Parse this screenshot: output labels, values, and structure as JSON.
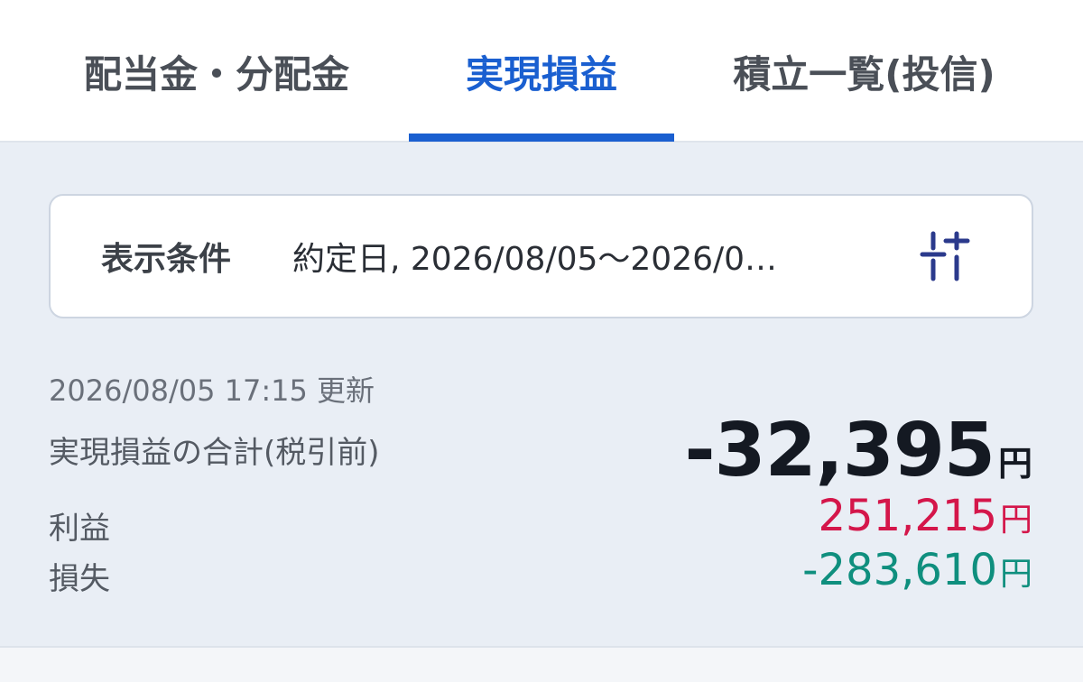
{
  "tabs": [
    {
      "label": "配当金・分配金",
      "active": false
    },
    {
      "label": "実現損益",
      "active": true
    },
    {
      "label": "積立一覧(投信)",
      "active": false
    }
  ],
  "filter": {
    "label": "表示条件",
    "value": "約定日, 2026/08/05〜2026/0…",
    "icon": "sliders-icon"
  },
  "summary": {
    "updated": "2026/08/05 17:15 更新",
    "total_label": "実現損益の合計(税引前)",
    "total_value": "-32,395",
    "total_unit": "円",
    "profit_label": "利益",
    "profit_value": "251,215",
    "profit_unit": "円",
    "loss_label": "損失",
    "loss_value": "-283,610",
    "loss_unit": "円"
  },
  "colors": {
    "accent": "#1a5fd0",
    "profit": "#d4164a",
    "loss": "#0f8f7e",
    "background": "#e9eef5"
  }
}
